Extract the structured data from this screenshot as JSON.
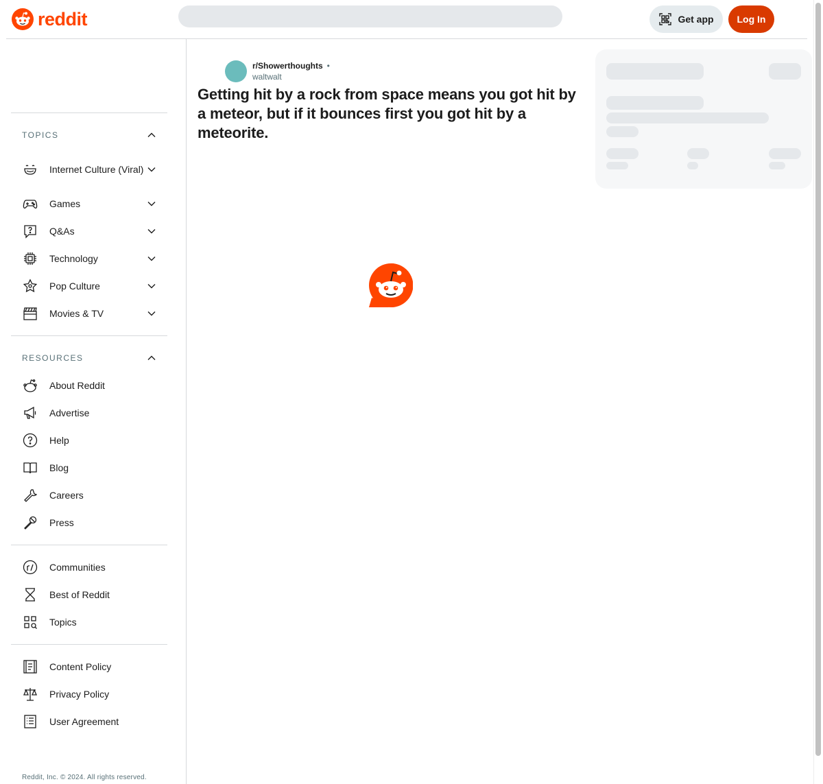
{
  "header": {
    "logo_text": "reddit",
    "get_app_label": "Get app",
    "login_label": "Log In"
  },
  "sidebar": {
    "topics_heading": "TOPICS",
    "topics": [
      {
        "label": "Internet Culture (Viral)",
        "icon": "smiley-icon"
      },
      {
        "label": "Games",
        "icon": "gamepad-icon"
      },
      {
        "label": "Q&As",
        "icon": "question-bubble-icon"
      },
      {
        "label": "Technology",
        "icon": "chip-icon"
      },
      {
        "label": "Pop Culture",
        "icon": "star-icon"
      },
      {
        "label": "Movies & TV",
        "icon": "clapperboard-icon"
      }
    ],
    "resources_heading": "RESOURCES",
    "resources": [
      {
        "label": "About Reddit",
        "icon": "snoo-icon"
      },
      {
        "label": "Advertise",
        "icon": "megaphone-icon"
      },
      {
        "label": "Help",
        "icon": "help-icon"
      },
      {
        "label": "Blog",
        "icon": "book-icon"
      },
      {
        "label": "Careers",
        "icon": "wrench-icon"
      },
      {
        "label": "Press",
        "icon": "microphone-icon"
      }
    ],
    "explore": [
      {
        "label": "Communities",
        "icon": "communities-icon"
      },
      {
        "label": "Best of Reddit",
        "icon": "hourglass-icon"
      },
      {
        "label": "Topics",
        "icon": "topics-grid-icon"
      }
    ],
    "policies": [
      {
        "label": "Content Policy",
        "icon": "content-policy-icon"
      },
      {
        "label": "Privacy Policy",
        "icon": "scales-icon"
      },
      {
        "label": "User Agreement",
        "icon": "document-list-icon"
      }
    ],
    "footer": "Reddit, Inc. © 2024. All rights reserved."
  },
  "post": {
    "subreddit": "r/Showerthoughts",
    "separator": "•",
    "author": "waltwalt",
    "title": "Getting hit by a rock from space means you got hit by a meteor, but if it bounces first you got hit by a meteorite."
  },
  "colors": {
    "brand": "#ff4500",
    "login_bg": "#d93a00",
    "avatar": "#6bbcbc"
  }
}
